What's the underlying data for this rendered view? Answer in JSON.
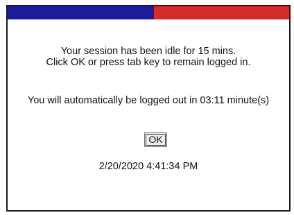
{
  "colors": {
    "title_bar_left": "#1a1c9a",
    "title_bar_right": "#d32a2a",
    "border": "#1a1a1a"
  },
  "message": {
    "line1": "Your session has been idle for 15 mins.",
    "line2": "Click OK or press tab key to remain logged in.",
    "countdown_prefix": "You will automatically be logged out in ",
    "countdown_time": "03:11",
    "countdown_suffix": " minute(s)"
  },
  "buttons": {
    "ok_label": "OK"
  },
  "timestamp": "2/20/2020 4:41:34 PM"
}
